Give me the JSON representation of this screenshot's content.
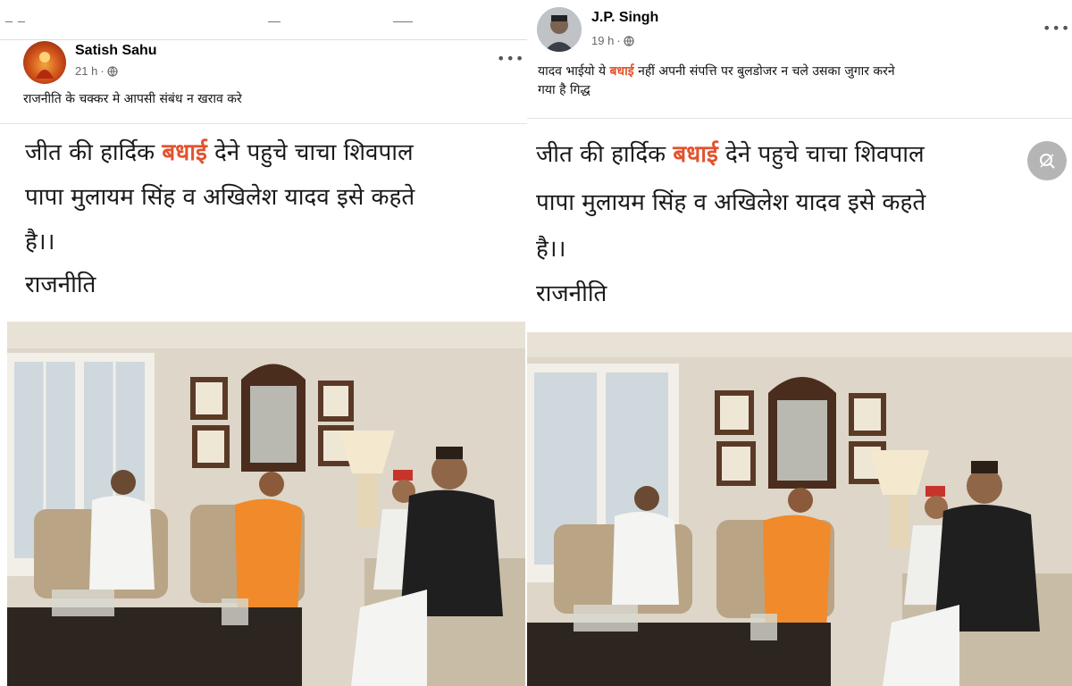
{
  "left_post": {
    "author": "Satish Sahu",
    "time": "21 h",
    "caption": "राजनीति के चक्कर मे आपसी संबंध न खराव करे",
    "image_text": {
      "line1_pre": "जीत की हार्दिक ",
      "line1_highlight": "बधाई",
      "line1_post": " देने पहुचे चाचा शिवपाल",
      "line2": "पापा मुलायम सिंह व अखिलेश यादव इसे कहते",
      "line3": "है।।",
      "line4": "राजनीति"
    }
  },
  "right_post": {
    "author": "J.P. Singh",
    "time": "19 h",
    "caption_pre": "यादव भाईयो ये ",
    "caption_highlight": "बधाई",
    "caption_post": " नहीं अपनी संपत्ति पर बुलडोजर न चले उसका जुगार करने",
    "caption_line2": "गया है  गिद्ध",
    "image_text": {
      "line1_pre": "जीत की हार्दिक ",
      "line1_highlight": "बधाई",
      "line1_post": " देने पहुचे चाचा शिवपाल",
      "line2": "पापा मुलायम सिंह व अखिलेश यादव इसे कहते",
      "line3": "है।।",
      "line4": "राजनीति"
    }
  },
  "icons": {
    "privacy": "globe-icon",
    "menu": "more-options-icon",
    "zoom": "zoom-icon"
  },
  "colors": {
    "highlight": "#e2532d",
    "meta": "#65676b",
    "background": "#e9ebee"
  }
}
